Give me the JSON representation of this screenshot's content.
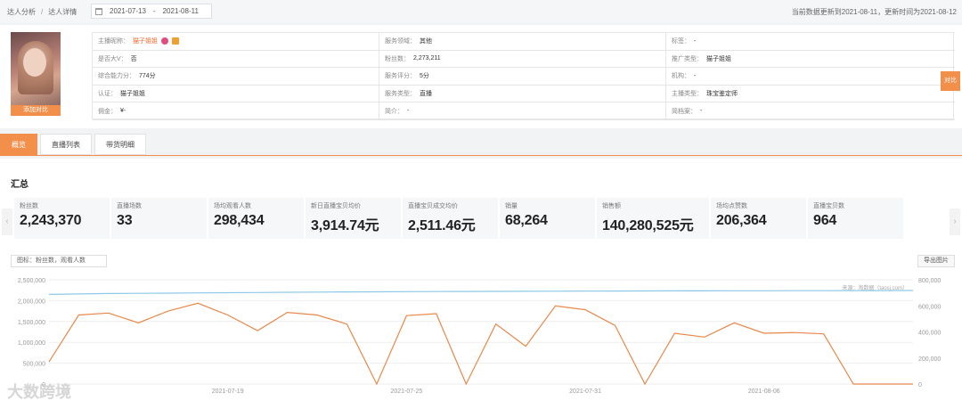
{
  "breadcrumb": {
    "items": [
      "达人分析",
      "达人详情"
    ],
    "sep": "/"
  },
  "date_range": {
    "start": "2021-07-13",
    "end": "2021-08-11",
    "sep": "-"
  },
  "update_info": "当前数据更新到2021-08-11，更新时间为2021-08-12",
  "profile": {
    "avatar_button": "添加对比",
    "compare_button": "对比",
    "cells": [
      {
        "label": "主播昵称：",
        "value": "猫子姐姐",
        "orange": true
      },
      {
        "label": "服务领域：",
        "value": "其他"
      },
      {
        "label": "标签：",
        "value": "-"
      },
      {
        "label": "是否大V：",
        "value": "否"
      },
      {
        "label": "粉丝数：",
        "value": "2,273,211"
      },
      {
        "label": "推广类型：",
        "value": "猫子姐姐"
      },
      {
        "label": "综合能力分：",
        "value": "774分"
      },
      {
        "label": "服务评分：",
        "value": "5分"
      },
      {
        "label": "机构：",
        "value": "-"
      },
      {
        "label": "认证：",
        "value": "猫子姐姐"
      },
      {
        "label": "服务类型：",
        "value": "直播"
      },
      {
        "label": "主播类型：",
        "value": "珠宝鉴定师"
      },
      {
        "label": "佣金：",
        "value": "¥-"
      },
      {
        "label": "简介：",
        "value": "-"
      },
      {
        "label": "简档案：",
        "value": "-"
      }
    ]
  },
  "tabs": [
    "概览",
    "直播列表",
    "带货明细"
  ],
  "summary": {
    "title": "汇总",
    "left_arrow": "‹",
    "right_arrow": "›",
    "metrics": [
      {
        "label": "粉丝数",
        "value": "2,243,370"
      },
      {
        "label": "直播场数",
        "value": "33"
      },
      {
        "label": "场均观看人数",
        "value": "298,434"
      },
      {
        "label": "新日直播宝贝均价",
        "value": "3,914.74元"
      },
      {
        "label": "直播宝贝成交均价",
        "value": "2,511.46元"
      },
      {
        "label": "销量",
        "value": "68,264"
      },
      {
        "label": "销售额",
        "value": "140,280,525元"
      },
      {
        "label": "场均点赞数",
        "value": "206,364"
      },
      {
        "label": "直播宝贝数",
        "value": "964"
      }
    ],
    "legend_select": "图标：粉丝数，观看人数",
    "export_button": "导出图片",
    "watermark": "大数跨境",
    "source_note": "来源：淘数据（taosj.com）"
  },
  "chart_data": {
    "type": "line",
    "x_tick_labels": [
      "2021-07-19",
      "2021-07-25",
      "2021-07-31",
      "2021-08-06"
    ],
    "y_left_ticks": [
      "2,500,000",
      "2,000,000",
      "1,500,000",
      "1,000,000",
      "500,000",
      "0"
    ],
    "y_right_ticks": [
      "800,000",
      "600,000",
      "400,000",
      "200,000",
      "0"
    ],
    "ylim_left": [
      0,
      2500000
    ],
    "ylim_right": [
      0,
      800000
    ],
    "grid": true,
    "series": [
      {
        "axis": "left",
        "color": "#8ec8e8",
        "values": [
          2150000,
          2160000,
          2170000,
          2175000,
          2180000,
          2185000,
          2190000,
          2195000,
          2200000,
          2205000,
          2210000,
          2212000,
          2215000,
          2217000,
          2220000,
          2222000,
          2224000,
          2226000,
          2228000,
          2230000,
          2232000,
          2234000,
          2236000,
          2237000,
          2238000,
          2239000,
          2240000,
          2241000,
          2242000,
          2243370
        ]
      },
      {
        "axis": "right",
        "color": "#e8884a",
        "values": [
          170000,
          530000,
          545000,
          470000,
          560000,
          620000,
          530000,
          410000,
          550000,
          530000,
          460000,
          0,
          525000,
          540000,
          0,
          460000,
          290000,
          600000,
          570000,
          450000,
          0,
          390000,
          360000,
          470000,
          390000,
          395000,
          385000,
          0,
          0,
          0
        ]
      }
    ]
  }
}
